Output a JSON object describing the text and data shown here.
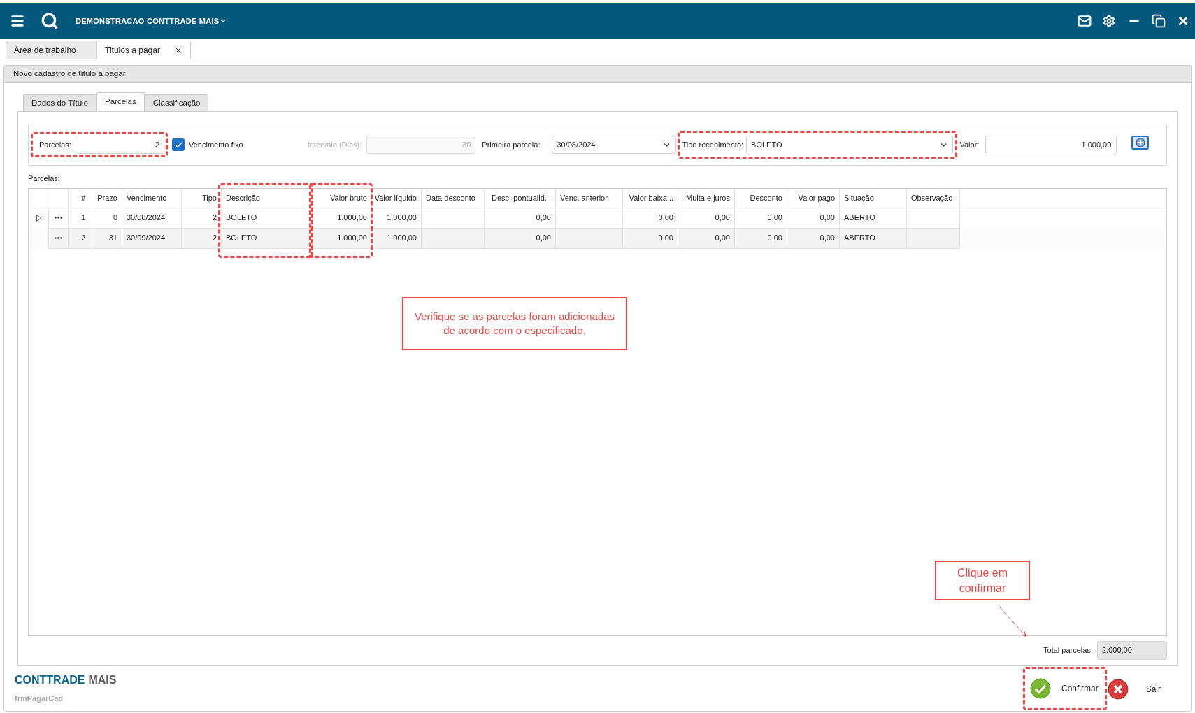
{
  "app_bar": {
    "title": "DEMONSTRACAO CONTTRADE MAIS"
  },
  "window_tabs": [
    {
      "label": "Área de trabalho",
      "selected": false,
      "closable": false
    },
    {
      "label": "Titulos a pagar",
      "selected": true,
      "closable": true
    }
  ],
  "form": {
    "title": "Novo cadastro de título a pagar",
    "tabs": [
      {
        "label": "Dados do Título",
        "selected": false
      },
      {
        "label": "Parcelas",
        "selected": true
      },
      {
        "label": "Classificação",
        "selected": false
      }
    ],
    "fields": {
      "parcelas": {
        "label": "Parcelas:",
        "value": "2",
        "highlighted": true
      },
      "vencimento_fixo": {
        "label": "Vencimento fixo",
        "checked": true
      },
      "intervalo": {
        "label": "Intervalo (Dias):",
        "value": "30",
        "disabled": true
      },
      "primeira_parcela": {
        "label": "Primeira parcela:",
        "value": "30/08/2024"
      },
      "tipo_recebimento": {
        "label": "Tipo recebimento:",
        "value": "BOLETO",
        "highlighted": true
      },
      "valor": {
        "label": "Valor:",
        "value": "1.000,00"
      }
    },
    "table": {
      "label": "Parcelas:",
      "columns": [
        {
          "label": "#",
          "kind": "number",
          "highlighted": false
        },
        {
          "label": "Prazo",
          "kind": "number",
          "highlighted": false
        },
        {
          "label": "Vencimento",
          "kind": "text",
          "highlighted": false
        },
        {
          "label": "Tipo",
          "kind": "number",
          "highlighted": false
        },
        {
          "label": "Descrição",
          "kind": "text",
          "highlighted": true
        },
        {
          "label": "Valor bruto",
          "kind": "number",
          "highlighted": true
        },
        {
          "label": "Valor líquido",
          "kind": "number",
          "highlighted": false
        },
        {
          "label": "Data desconto",
          "kind": "text",
          "highlighted": false
        },
        {
          "label": "Desc. pontualid...",
          "kind": "number",
          "highlighted": false
        },
        {
          "label": "Venc. anterior",
          "kind": "text",
          "highlighted": false
        },
        {
          "label": "Valor baixa...",
          "kind": "number",
          "highlighted": false
        },
        {
          "label": "Multa e juros",
          "kind": "number",
          "highlighted": false
        },
        {
          "label": "Desconto",
          "kind": "number",
          "highlighted": false
        },
        {
          "label": "Valor pago",
          "kind": "number",
          "highlighted": false
        },
        {
          "label": "Situação",
          "kind": "text",
          "highlighted": false
        },
        {
          "label": "Observação",
          "kind": "text",
          "highlighted": false
        }
      ],
      "rows": [
        {
          "current": true,
          "cells": [
            "1",
            "0",
            "30/08/2024",
            "2",
            "BOLETO",
            "1.000,00",
            "1.000,00",
            null,
            "0,00",
            null,
            "0,00",
            "0,00",
            "0,00",
            "0,00",
            "ABERTO",
            null
          ]
        },
        {
          "current": false,
          "cells": [
            "2",
            "31",
            "30/09/2024",
            "2",
            "BOLETO",
            "1.000,00",
            "1.000,00",
            null,
            "0,00",
            null,
            "0,00",
            "0,00",
            "0,00",
            "0,00",
            "ABERTO",
            null
          ]
        }
      ]
    },
    "total": {
      "label": "Total parcelas:",
      "value": "2.000,00"
    }
  },
  "footer": {
    "brand_primary": "CONTTRADE",
    "brand_secondary": "MAIS",
    "form_name": "frmPagarCad",
    "buttons": [
      {
        "kind": "confirm",
        "label": "Confirmar",
        "highlighted": true
      },
      {
        "kind": "exit",
        "label": "Sair",
        "highlighted": false
      }
    ]
  },
  "annotations": [
    {
      "kind": "table_note",
      "text": "Verifique se as parcelas foram adicionadas de acordo com o especificado."
    },
    {
      "kind": "confirm_note",
      "text": "Clique em confirmar"
    }
  ]
}
